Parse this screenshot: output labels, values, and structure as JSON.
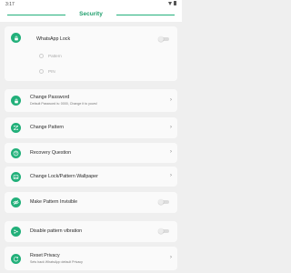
{
  "status_bar": {
    "time": "3:17",
    "wifi_icon": "wifi-icon",
    "battery_icon": "battery-icon"
  },
  "header": {
    "title": "Security"
  },
  "whatsapp_lock": {
    "label": "WhatsApp Lock",
    "enabled": false,
    "options": [
      "Pattern",
      "PIN"
    ],
    "icon": "lock-icon"
  },
  "settings": [
    {
      "id": "change-password",
      "label": "Change Password",
      "subtitle": "Default Password is: 0000, Change it to yours!",
      "icon": "lock-icon",
      "control": "chevron"
    },
    {
      "id": "change-pattern",
      "label": "Change Pattern",
      "icon": "pattern-icon",
      "control": "chevron"
    },
    {
      "id": "recovery-question",
      "label": "Recovery Question",
      "icon": "question-icon",
      "control": "chevron"
    },
    {
      "id": "change-wallpaper",
      "label": "Change Lock/Pattern Wallpaper",
      "icon": "wallpaper-icon",
      "control": "chevron"
    },
    {
      "id": "pattern-invisible",
      "label": "Make Pattern Invisible",
      "icon": "eye-off-icon",
      "control": "toggle",
      "enabled": false
    },
    {
      "id": "pattern-vibration",
      "label": "Disable pattern vibration",
      "icon": "vibration-icon",
      "control": "toggle",
      "enabled": false
    },
    {
      "id": "reset-privacy",
      "label": "Reset Privacy",
      "subtitle": "Sets back WhatsApp default Privacy",
      "icon": "reset-icon",
      "control": "chevron"
    }
  ],
  "colors": {
    "accent": "#22b07a",
    "background": "#efefef",
    "card": "#fafafa"
  }
}
